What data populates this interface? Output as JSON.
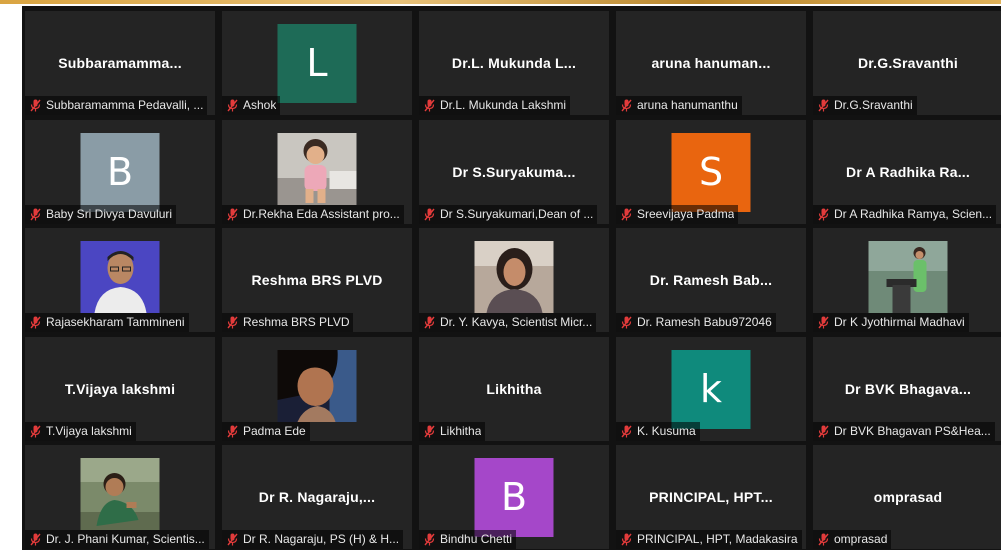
{
  "icons": {
    "mic": "mic-muted-icon"
  },
  "colors": {
    "green": "#1e6b57",
    "slate": "#8a9ca6",
    "orange": "#e9650f",
    "teal": "#0f8a7c",
    "purple": "#a547c9"
  },
  "tiles": [
    {
      "name": "Subbaramamma...",
      "label": "Subbaramamma Pedavalli, ..."
    },
    {
      "avatar": "L",
      "avatarColor": "#1e6b57",
      "label": "Ashok"
    },
    {
      "name": "Dr.L. Mukunda L...",
      "label": "Dr.L. Mukunda Lakshmi"
    },
    {
      "name": "aruna hanuman...",
      "label": "aruna hanumanthu"
    },
    {
      "name": "Dr.G.Sravanthi",
      "label": "Dr.G.Sravanthi"
    },
    {
      "avatar": "B",
      "avatarColor": "#8a9ca6",
      "label": "Baby Sri Divya Davuluri"
    },
    {
      "photo": "child",
      "label": "Dr.Rekha Eda Assistant pro..."
    },
    {
      "name": "Dr S.Suryakuma...",
      "label": "Dr S.Suryakumari,Dean of ..."
    },
    {
      "avatar": "S",
      "avatarColor": "#e9650f",
      "label": "Sreevijaya Padma"
    },
    {
      "name": "Dr A Radhika Ra...",
      "label": "Dr A Radhika Ramya, Scien..."
    },
    {
      "photo": "man1",
      "label": "Rajasekharam Tammineni"
    },
    {
      "name": "Reshma BRS PLVD",
      "label": "Reshma BRS PLVD"
    },
    {
      "photo": "woman1",
      "label": "Dr. Y. Kavya, Scientist Micr..."
    },
    {
      "name": "Dr. Ramesh Bab...",
      "label": "Dr. Ramesh Babu972046"
    },
    {
      "photo": "podium",
      "label": "Dr K Jyothirmai Madhavi"
    },
    {
      "name": "T.Vijaya lakshmi",
      "label": "T.Vijaya lakshmi"
    },
    {
      "photo": "woman2",
      "label": "Padma Ede"
    },
    {
      "name": "Likhitha",
      "label": "Likhitha"
    },
    {
      "avatar": "k",
      "avatarColor": "#0f8a7c",
      "label": "K. Kusuma"
    },
    {
      "name": "Dr BVK Bhagava...",
      "label": "Dr BVK Bhagavan PS&Hea..."
    },
    {
      "photo": "man2",
      "label": "Dr. J. Phani Kumar, Scientis..."
    },
    {
      "name": "Dr R. Nagaraju,...",
      "label": "Dr R. Nagaraju, PS (H) & H..."
    },
    {
      "avatar": "B",
      "avatarColor": "#a547c9",
      "label": "Bindhu Chetti"
    },
    {
      "name": "PRINCIPAL, HPT...",
      "label": "PRINCIPAL, HPT, Madakasira"
    },
    {
      "name": "omprasad",
      "label": "omprasad"
    }
  ]
}
